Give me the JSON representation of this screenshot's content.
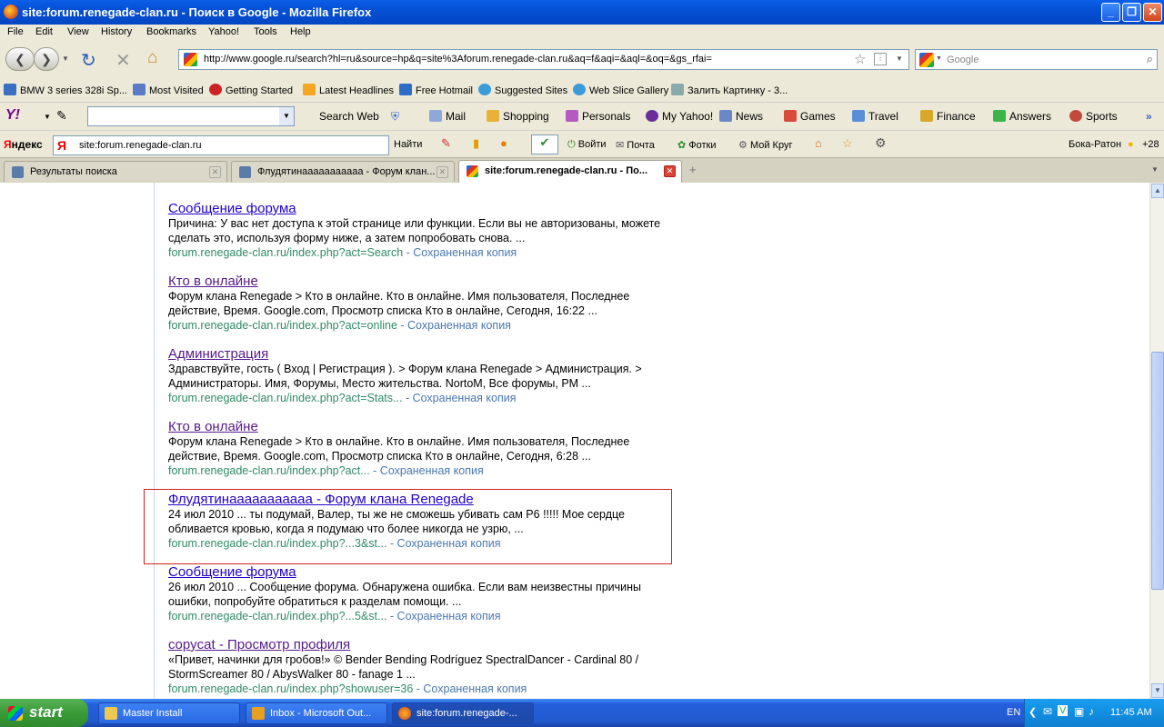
{
  "window": {
    "title": "site:forum.renegade-clan.ru - Поиск в Google - Mozilla Firefox"
  },
  "menu": [
    "File",
    "Edit",
    "View",
    "History",
    "Bookmarks",
    "Yahoo!",
    "Tools",
    "Help"
  ],
  "nav": {
    "url": "http://www.google.ru/search?hl=ru&source=hp&q=site%3Aforum.renegade-clan.ru&aq=f&aqi=&aql=&oq=&gs_rfai=",
    "search_placeholder": "Google"
  },
  "bookmarks": [
    "BMW 3 series 328i Sp...",
    "Most Visited",
    "Getting Started",
    "Latest Headlines",
    "Free Hotmail",
    "Suggested Sites",
    "Web Slice Gallery",
    "Залить Картинку - 3..."
  ],
  "yahoo": {
    "logo": "Y!",
    "search_web": "Search Web",
    "items": [
      "Mail",
      "Shopping",
      "Personals",
      "My Yahoo!",
      "News",
      "Games",
      "Travel",
      "Finance",
      "Answers",
      "Sports"
    ]
  },
  "yandex": {
    "logo_prefix": "Я",
    "logo_rest": "ндекс",
    "query": "site:forum.renegade-clan.ru",
    "find": "Найти",
    "login": "Войти",
    "mail": "Почта",
    "photos": "Фотки",
    "circle": "Мой Круг",
    "city": "Бока-Ратон",
    "temp": "+28"
  },
  "tabs": [
    {
      "label": "Результаты поиска"
    },
    {
      "label": "Флудятинааааааааааа - Форум клан..."
    },
    {
      "label": "site:forum.renegade-clan.ru - По..."
    }
  ],
  "results": [
    {
      "title": "Сообщение форума",
      "snippet": "Причина: У вас нет доступа к этой странице или функции. Если вы не авторизованы, можете сделать это, используя форму ниже, а затем попробовать снова. ...",
      "url": "forum.renegade-clan.ru/index.php?act=Search",
      "cache": "- Сохраненная копия"
    },
    {
      "title": "Кто в онлайне",
      "snippet": "Форум клана Renegade > Кто в онлайне. Кто в онлайне. Имя пользователя, Последнее действие, Время. Google.com, Просмотр списка Кто в онлайне, Сегодня, 16:22 ...",
      "url": "forum.renegade-clan.ru/index.php?act=online",
      "cache": "- Сохраненная копия"
    },
    {
      "title": "Администрация",
      "snippet": "Здравствуйте, гость ( Вход | Регистрация ). > Форум клана Renegade > Администрация. > Администраторы. Имя, Форумы, Место жительства. NortoM, Все форумы, PM ...",
      "url": "forum.renegade-clan.ru/index.php?act=Stats...",
      "cache": "- Сохраненная копия"
    },
    {
      "title": "Кто в онлайне",
      "snippet": "Форум клана Renegade > Кто в онлайне. Кто в онлайне. Имя пользователя, Последнее действие, Время. Google.com, Просмотр списка Кто в онлайне, Сегодня, 6:28 ...",
      "url": "forum.renegade-clan.ru/index.php?act...",
      "cache": "- Сохраненная копия"
    },
    {
      "title": "Флудятинааааааааааа - Форум клана Renegade",
      "snippet": "24 июл 2010 ... ты подумай, Валер, ты же не сможешь убивать сам Р6 !!!!! Мое сердце обливается кровью, когда я подумаю что более никогда не узрю, ...",
      "url": "forum.renegade-clan.ru/index.php?...3&st...",
      "cache": "- Сохраненная копия"
    },
    {
      "title": "Сообщение форума",
      "snippet": "26 июл 2010 ... Сообщение форума. Обнаружена ошибка. Если вам неизвестны причины ошибки, попробуйте обратиться к разделам помощи. ...",
      "url": "forum.renegade-clan.ru/index.php?...5&st...",
      "cache": "- Сохраненная копия"
    },
    {
      "title": "copycat - Просмотр профиля",
      "snippet": "«Привет, начинки для гробов!» © Bender Bending Rodríguez SpectralDancer - Cardinal 80 / StormScreamer 80 / AbysWalker 80 - fanage 1 ...",
      "url": "forum.renegade-clan.ru/index.php?showuser=36",
      "cache": "- Сохраненная копия"
    }
  ],
  "taskbar": {
    "start": "start",
    "tasks": [
      "Master Install",
      "Inbox - Microsoft Out...",
      "site:forum.renegade-..."
    ],
    "lang": "EN",
    "clock": "11:45 AM"
  }
}
